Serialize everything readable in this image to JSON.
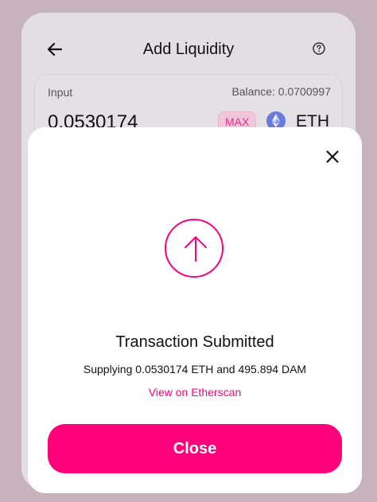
{
  "background": {
    "title": "Add Liquidity",
    "input": {
      "label": "Input",
      "balance": "Balance: 0.0700997",
      "amount": "0.0530174",
      "max_label": "MAX",
      "token": "ETH"
    },
    "icons": {
      "back": "arrow-left-icon",
      "help": "question-circle-icon",
      "token": "ethereum-icon"
    }
  },
  "modal": {
    "title": "Transaction Submitted",
    "description": "Supplying 0.0530174 ETH and 495.894 DAM",
    "link_label": "View on Etherscan",
    "close_label": "Close",
    "icons": {
      "close": "close-icon",
      "status": "arrow-up-circle-icon"
    }
  },
  "colors": {
    "accent": "#ff007a",
    "accent_soft": "#efc6da",
    "overlay": "#c6b3bd"
  }
}
